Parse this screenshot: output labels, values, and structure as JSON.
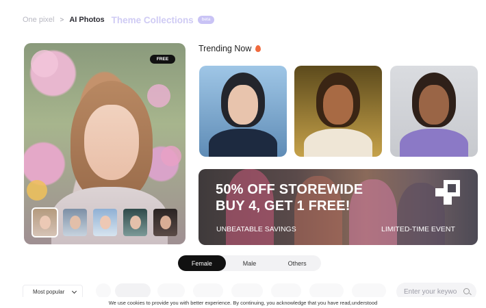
{
  "breadcrumb": {
    "home": "One pixel",
    "separator": ">",
    "current": "AI Photos",
    "theme": "Theme Collections",
    "badge": "beta"
  },
  "hero": {
    "badge": "FREE",
    "thumbnails": [
      {
        "name": "style-1",
        "active": true
      },
      {
        "name": "style-2",
        "active": false
      },
      {
        "name": "style-3",
        "active": false
      },
      {
        "name": "style-4",
        "active": false
      },
      {
        "name": "style-5",
        "active": false
      }
    ]
  },
  "trending": {
    "title": "Trending Now",
    "icon": "fire-icon"
  },
  "promo": {
    "line1": "50% OFF STOREWIDE",
    "line2": "BUY 4, GET 1 FREE!",
    "sub_left": "UNBEATABLE SAVINGS",
    "sub_right": "LIMITED-TIME EVENT"
  },
  "gender_tabs": [
    "Female",
    "Male",
    "Others"
  ],
  "filters": {
    "sort_selected": "Most popular",
    "search_placeholder": "Enter your keywo"
  },
  "cookie": {
    "text": "We use cookies to provide you with better experience. By continuing, you acknowledge that you have read,understood"
  },
  "colors": {
    "accent": "#c9c3f5",
    "active_tab": "#111111",
    "fire": "#f06a3e"
  }
}
